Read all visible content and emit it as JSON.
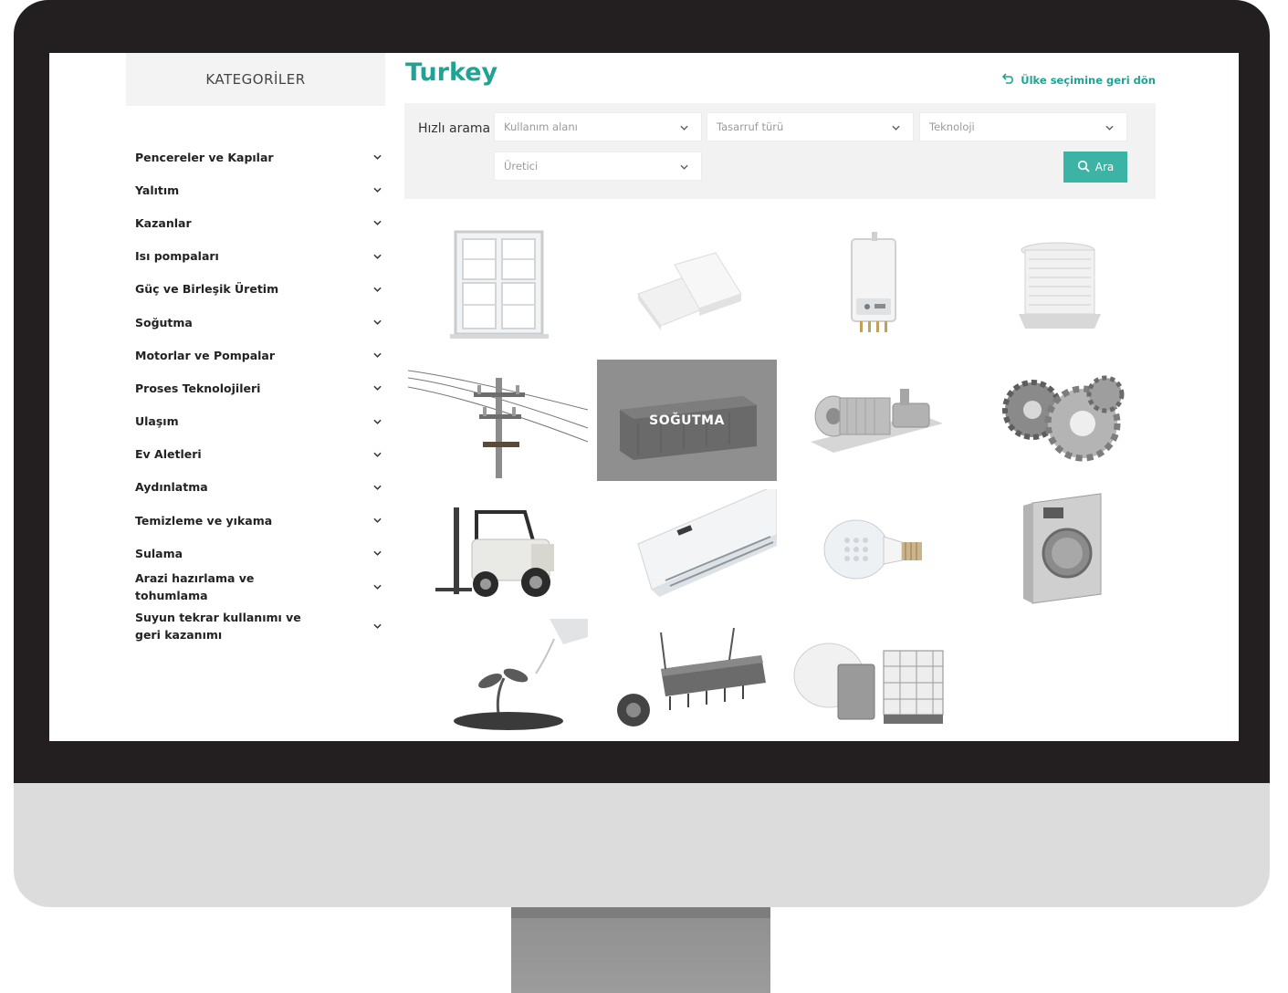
{
  "sidebar": {
    "header": "KATEGORİLER",
    "items": [
      {
        "label": "Pencereler ve Kapılar"
      },
      {
        "label": "Yalıtım"
      },
      {
        "label": "Kazanlar"
      },
      {
        "label": "Isı pompaları"
      },
      {
        "label": "Güç ve Birleşik Üretim"
      },
      {
        "label": "Soğutma"
      },
      {
        "label": "Motorlar ve Pompalar"
      },
      {
        "label": "Proses Teknolojileri"
      },
      {
        "label": "Ulaşım"
      },
      {
        "label": "Ev Aletleri"
      },
      {
        "label": "Aydınlatma"
      },
      {
        "label": "Temizleme ve yıkama"
      },
      {
        "label": "Sulama"
      },
      {
        "label": "Arazi hazırlama ve tohumlama"
      },
      {
        "label": "Suyun tekrar kullanımı ve geri kazanımı"
      }
    ]
  },
  "main": {
    "title": "Turkey",
    "back_link": "Ülke seçimine geri dön",
    "search": {
      "label": "Hızlı arama",
      "usage_placeholder": "Kullanım alanı",
      "saving_placeholder": "Tasarruf türü",
      "technology_placeholder": "Teknoloji",
      "manufacturer_placeholder": "Üretici",
      "button_label": "Ara"
    },
    "grid": {
      "hover_label": "SOĞUTMA"
    }
  },
  "colors": {
    "accent": "#20a394",
    "button": "#3bb3a5",
    "panel": "#f2f2f2",
    "bezel": "#231f20",
    "chin": "#dcdcdc"
  }
}
